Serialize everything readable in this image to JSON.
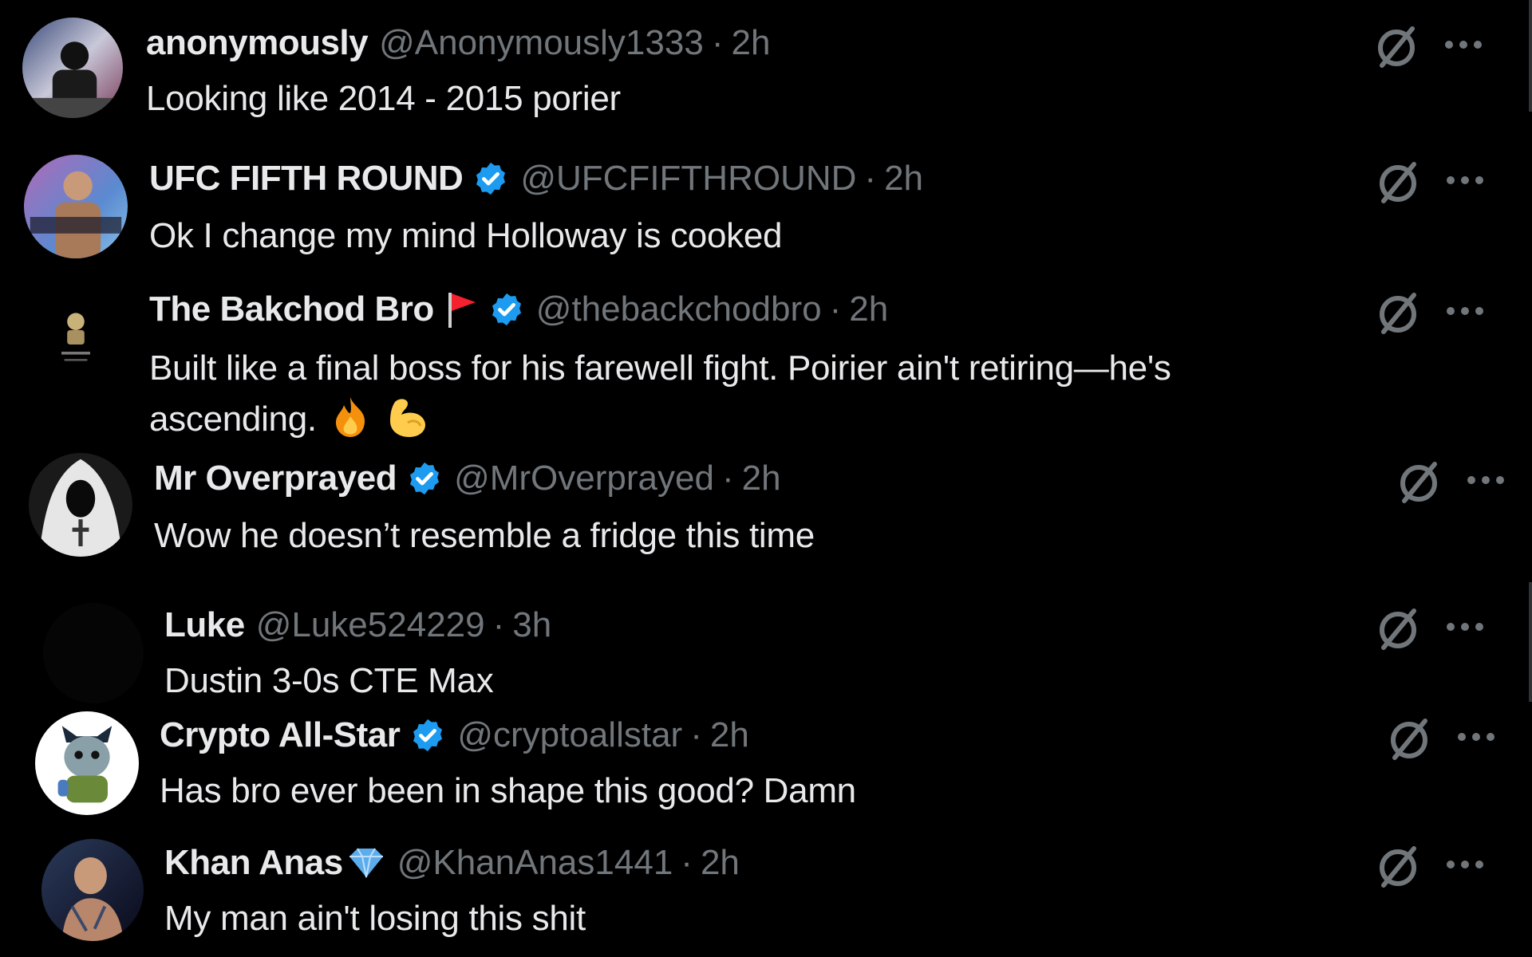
{
  "replies": [
    {
      "name": "anonymously",
      "handle": "@Anonymously1333",
      "sep": "·",
      "time": "2h",
      "text": "Looking like 2014 - 2015 porier"
    },
    {
      "name": "UFC FIFTH ROUND",
      "handle": "@UFCFIFTHROUND",
      "sep": "·",
      "time": "2h",
      "text": "Ok I change my mind Holloway is cooked",
      "verified": true
    },
    {
      "name": "The Bakchod Bro",
      "handle": "@thebackchodbro",
      "sep": "·",
      "time": "2h",
      "text_line1": "Built like a final boss for his farewell fight. Poirier ain't retiring—he's",
      "text_line2": "ascending.",
      "verified": true,
      "name_emoji": "red-flag-icon",
      "text_emoji": [
        "fire-icon",
        "flexed-biceps-icon"
      ]
    },
    {
      "name": "Mr Overprayed",
      "handle": "@MrOverprayed",
      "sep": "·",
      "time": "2h",
      "text": "Wow he doesn’t resemble a fridge this time",
      "verified": true
    },
    {
      "name": "Luke",
      "handle": "@Luke524229",
      "sep": "·",
      "time": "3h",
      "text": "Dustin 3-0s CTE Max"
    },
    {
      "name": "Crypto All-Star",
      "handle": "@cryptoallstar",
      "sep": "·",
      "time": "2h",
      "text": "Has bro ever been in shape this good? Damn",
      "verified": true
    },
    {
      "name": "Khan Anas",
      "handle": "@KhanAnas1441",
      "sep": "·",
      "time": "2h",
      "text": "My man ain't losing this shit",
      "name_emoji": "gem-icon"
    }
  ],
  "icons": {
    "action": "grok-slash-icon",
    "more": "more-icon",
    "verified": "verified-badge-icon"
  },
  "colors": {
    "background": "#000000",
    "text": "#e7e9ea",
    "secondary": "#71767b",
    "verified": "#1d9bf0",
    "flag": "#f4212e"
  }
}
